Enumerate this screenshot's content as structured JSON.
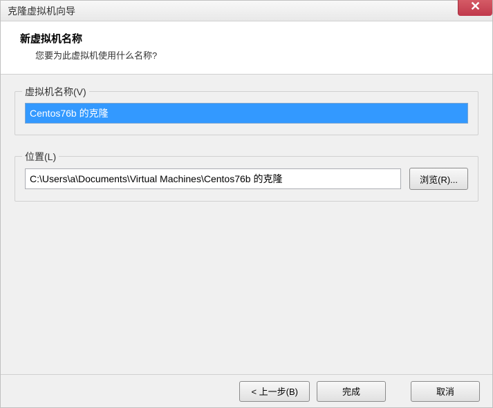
{
  "titlebar": {
    "title": "克隆虚拟机向导"
  },
  "header": {
    "title": "新虚拟机名称",
    "subtitle": "您要为此虚拟机使用什么名称?"
  },
  "vm_name": {
    "legend": "虚拟机名称(V)",
    "value": "Centos76b 的克隆"
  },
  "location": {
    "legend": "位置(L)",
    "value": "C:\\Users\\a\\Documents\\Virtual Machines\\Centos76b 的克隆",
    "browse_label": "浏览(R)..."
  },
  "footer": {
    "back_label": "< 上一步(B)",
    "finish_label": "完成",
    "cancel_label": "取消"
  }
}
